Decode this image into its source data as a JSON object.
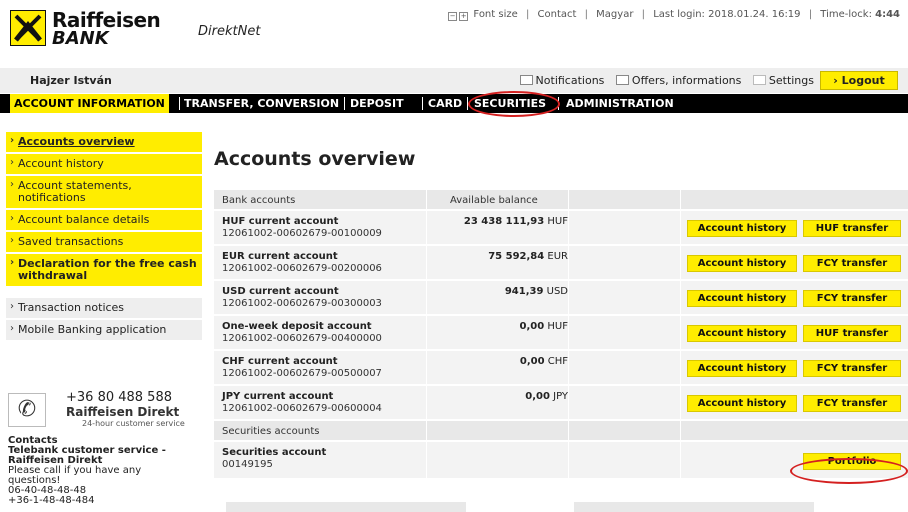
{
  "brand": {
    "logo_line1": "Raiffeisen",
    "logo_line2": "BANK",
    "product": "DirektNet",
    "accent_color": "#ffed00"
  },
  "toplinks": {
    "font_size": "Font size",
    "contact": "Contact",
    "language": "Magyar",
    "last_login": "Last login: 2018.01.24. 16:19",
    "timelock_label": "Time-lock:",
    "timelock_value": "4:44"
  },
  "userbar": {
    "username": "Hajzer István",
    "notifications": "Notifications",
    "offers": "Offers, informations",
    "settings": "Settings",
    "logout": "Logout"
  },
  "nav": {
    "items": [
      {
        "label": "ACCOUNT INFORMATION"
      },
      {
        "label": "TRANSFER, CONVERSION"
      },
      {
        "label": "DEPOSIT"
      },
      {
        "label": "CARD"
      },
      {
        "label": "SECURITIES"
      },
      {
        "label": "ADMINISTRATION"
      }
    ]
  },
  "sidebar": {
    "items": [
      {
        "label": "Accounts overview"
      },
      {
        "label": "Account history"
      },
      {
        "label": "Account statements, notifications"
      },
      {
        "label": "Account balance details"
      },
      {
        "label": "Saved transactions"
      },
      {
        "label": "Declaration for the free cash withdrawal"
      }
    ],
    "extra": [
      {
        "label": "Transaction notices"
      },
      {
        "label": "Mobile Banking application"
      }
    ],
    "phone": {
      "number": "+36 80 488 588",
      "name": "Raiffeisen Direkt",
      "sub": "24-hour customer service"
    },
    "contacts": {
      "title": "Contacts",
      "line1": "Telebank customer service -",
      "line2": "Raiffeisen Direkt",
      "line3": "Please call if you have any",
      "line4": "questions!",
      "line5": "06-40-48-48-48",
      "line6": "+36-1-48-48-484"
    }
  },
  "main": {
    "title": "Accounts overview",
    "bank_header": "Bank accounts",
    "balance_header": "Available balance",
    "accounts": [
      {
        "name": "HUF current account",
        "number": "12061002-00602679-00100009",
        "amount": "23 438 111,93",
        "currency": "HUF",
        "history": "Account history",
        "transfer": "HUF transfer"
      },
      {
        "name": "EUR current account",
        "number": "12061002-00602679-00200006",
        "amount": "75 592,84",
        "currency": "EUR",
        "history": "Account history",
        "transfer": "FCY transfer"
      },
      {
        "name": "USD current account",
        "number": "12061002-00602679-00300003",
        "amount": "941,39",
        "currency": "USD",
        "history": "Account history",
        "transfer": "FCY transfer"
      },
      {
        "name": "One-week deposit account",
        "number": "12061002-00602679-00400000",
        "amount": "0,00",
        "currency": "HUF",
        "history": "Account history",
        "transfer": "HUF transfer"
      },
      {
        "name": "CHF current account",
        "number": "12061002-00602679-00500007",
        "amount": "0,00",
        "currency": "CHF",
        "history": "Account history",
        "transfer": "FCY transfer"
      },
      {
        "name": "JPY current account",
        "number": "12061002-00602679-00600004",
        "amount": "0,00",
        "currency": "JPY",
        "history": "Account history",
        "transfer": "FCY transfer"
      }
    ],
    "securities_header": "Securities accounts",
    "securities": {
      "name": "Securities account",
      "number": "00149195",
      "portfolio": "Portfolio"
    }
  }
}
